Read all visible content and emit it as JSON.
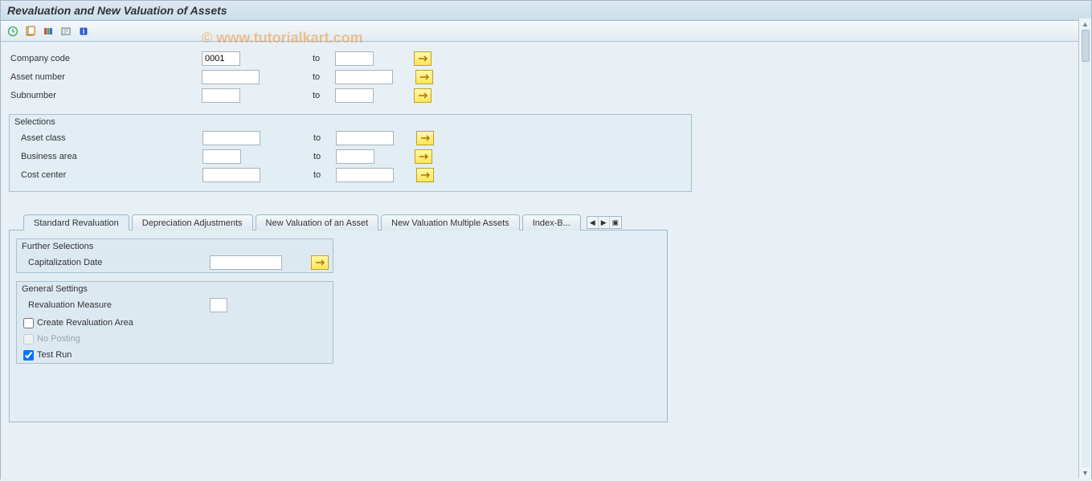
{
  "title": "Revaluation and New Valuation of Assets",
  "watermark": "© www.tutorialkart.com",
  "top": {
    "company_code_label": "Company code",
    "company_code_value": "0001",
    "asset_number_label": "Asset number",
    "subnumber_label": "Subnumber",
    "to_label": "to"
  },
  "selections": {
    "title": "Selections",
    "asset_class_label": "Asset class",
    "business_area_label": "Business area",
    "cost_center_label": "Cost center",
    "to_label": "to"
  },
  "tabs": {
    "t0": "Standard Revaluation",
    "t1": "Depreciation Adjustments",
    "t2": "New Valuation of an Asset",
    "t3": "New Valuation Multiple Assets",
    "t4": "Index-B..."
  },
  "further": {
    "title": "Further Selections",
    "capdate_label": "Capitalization Date"
  },
  "general": {
    "title": "General Settings",
    "reval_measure_label": "Revaluation Measure",
    "create_area_label": "Create Revaluation Area",
    "no_posting_label": "No Posting",
    "test_run_label": "Test Run"
  }
}
